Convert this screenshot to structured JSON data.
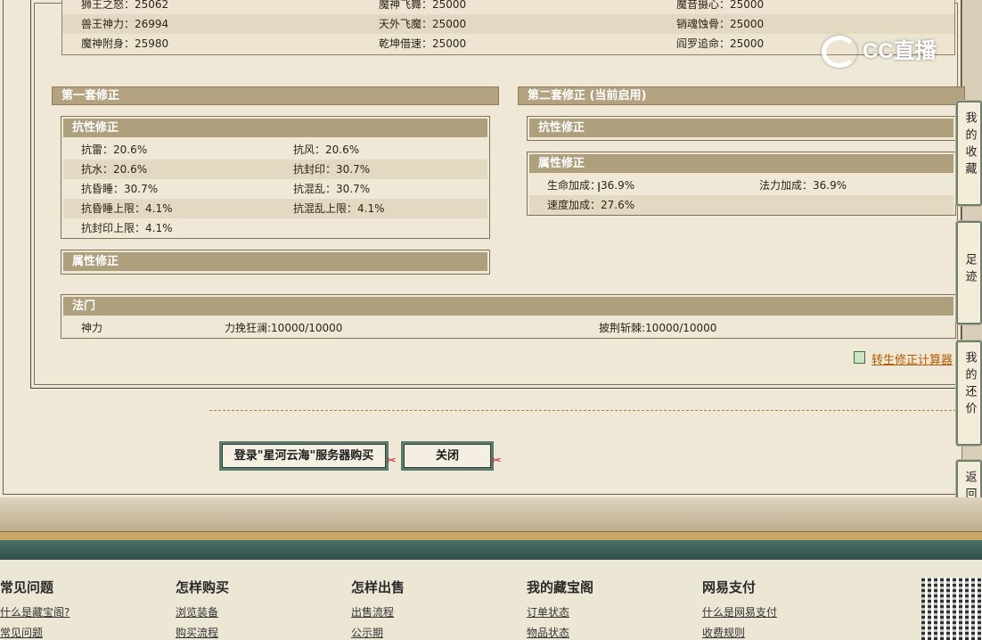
{
  "top_table": {
    "rows": [
      [
        "狮王之怒：25062",
        "魔神飞舞：25000",
        "魔音摄心：25000"
      ],
      [
        "兽王神力：26994",
        "天外飞魔：25000",
        "销魂蚀骨：25000"
      ],
      [
        "魔神附身：25980",
        "乾坤借速：25000",
        "阎罗追命：25000"
      ]
    ]
  },
  "set1": {
    "title": "第一套修正",
    "resist": {
      "title": "抗性修正",
      "rows": [
        [
          "抗雷：20.6%",
          "抗风：20.6%"
        ],
        [
          "抗水：20.6%",
          "抗封印：30.7%"
        ],
        [
          "抗昏睡：30.7%",
          "抗混乱：30.7%"
        ],
        [
          "抗昏睡上限：4.1%",
          "抗混乱上限：4.1%"
        ],
        [
          "抗封印上限：4.1%",
          ""
        ]
      ]
    },
    "attr": {
      "title": "属性修正"
    }
  },
  "set2": {
    "title": "第二套修正 (当前启用)",
    "resist": {
      "title": "抗性修正"
    },
    "attr": {
      "title": "属性修正",
      "rows": [
        [
          "生命加成：36.9%",
          "法力加成：36.9%"
        ],
        [
          "速度加成：27.6%",
          ""
        ]
      ]
    }
  },
  "fame": {
    "title": "法门",
    "row": [
      "神力",
      "力挽狂澜:10000/10000",
      "披荆斩棘:10000/10000"
    ]
  },
  "calc_link": "转生修正计算器",
  "buttons": {
    "buy": "登录\"星河云海\"服务器购买",
    "close": "关闭"
  },
  "side_tabs": [
    "我的收藏",
    "足迹",
    "我的还价",
    "返回顶部"
  ],
  "footer": {
    "columns": [
      {
        "title": "常见问题",
        "links": [
          "什么是藏宝阁?",
          "常见问题"
        ]
      },
      {
        "title": "怎样购买",
        "links": [
          "浏览装备",
          "购买流程"
        ]
      },
      {
        "title": "怎样出售",
        "links": [
          "出售流程",
          "公示期"
        ]
      },
      {
        "title": "我的藏宝阁",
        "links": [
          "订单状态",
          "物品状态"
        ]
      },
      {
        "title": "网易支付",
        "links": [
          "什么是网易支付",
          "收费规则"
        ]
      }
    ]
  },
  "watermark": "CC直播"
}
